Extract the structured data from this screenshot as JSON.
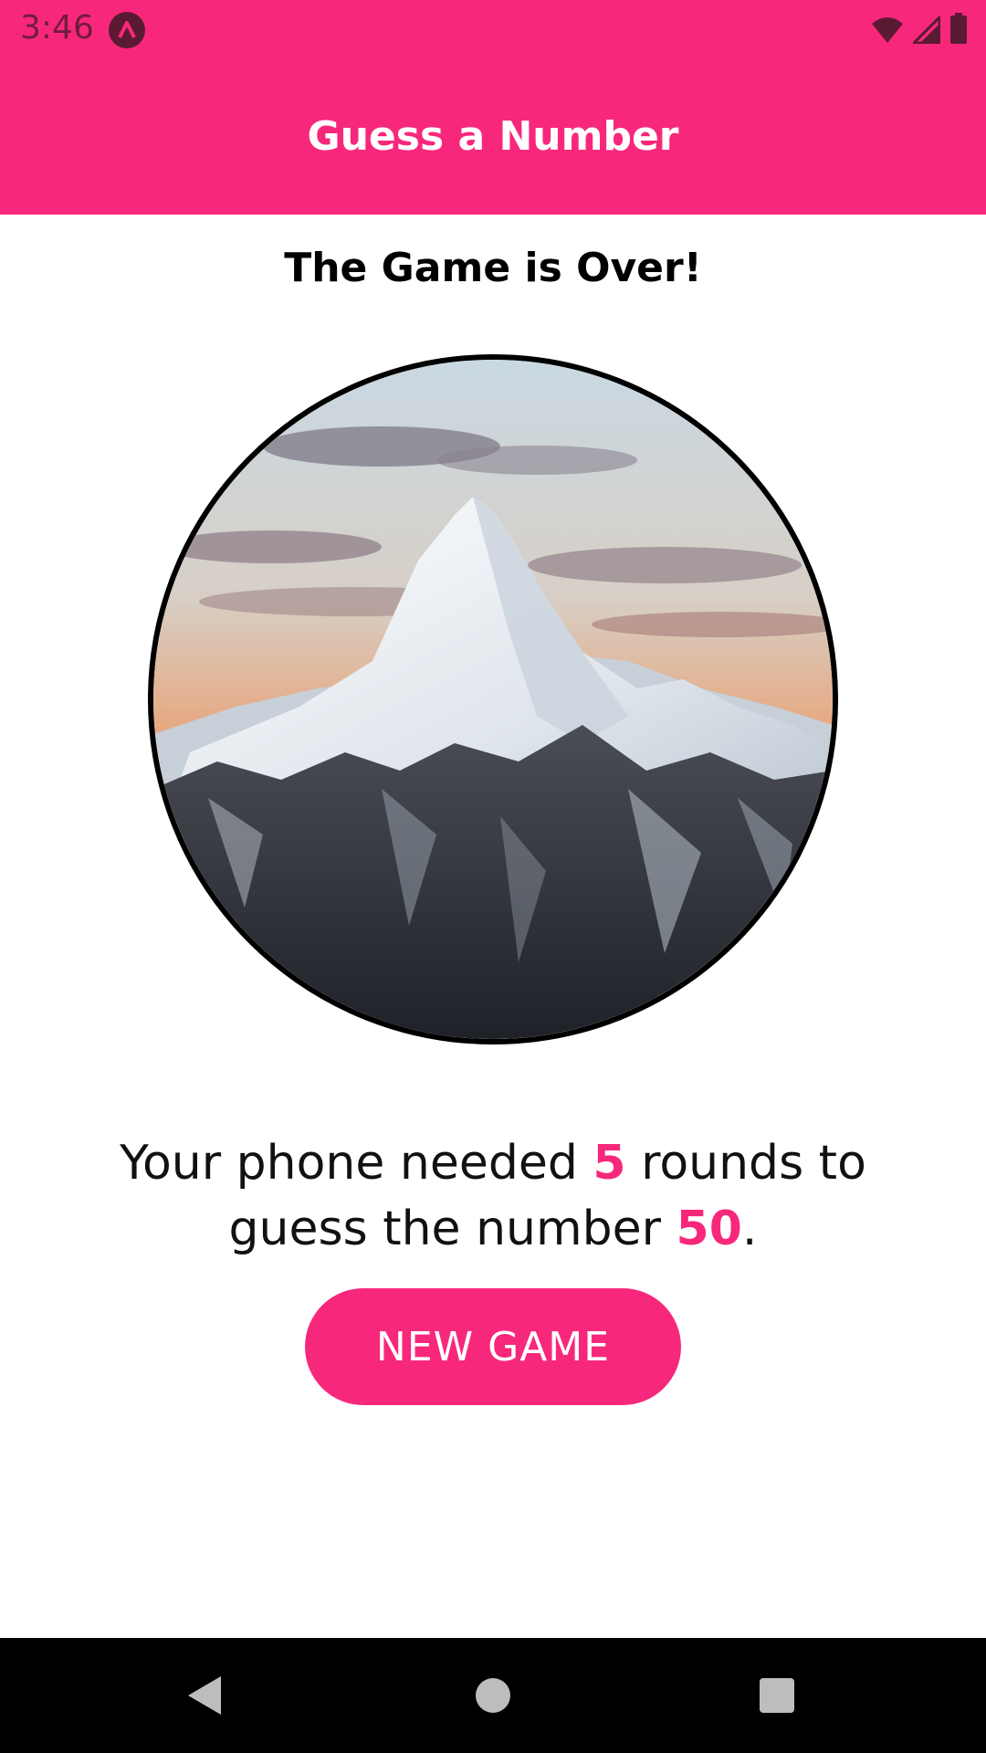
{
  "status_bar": {
    "time": "3:46",
    "app_icon": "react-native-icon",
    "icons": [
      "wifi-icon",
      "cell-signal-icon",
      "battery-icon"
    ]
  },
  "app_bar": {
    "title": "Guess a Number"
  },
  "main": {
    "heading": "The Game is Over!",
    "image": "mountain-summit-image",
    "summary": {
      "part1": "Your phone needed ",
      "rounds": "5",
      "part2": " rounds to guess the number ",
      "number": "50",
      "part3": "."
    },
    "new_game_label": "NEW GAME"
  },
  "nav_bar": {
    "icons": [
      "back-icon",
      "home-icon",
      "recents-icon"
    ]
  },
  "colors": {
    "accent": "#f7287b",
    "background": "#ffffff",
    "nav_bar": "#000000"
  }
}
